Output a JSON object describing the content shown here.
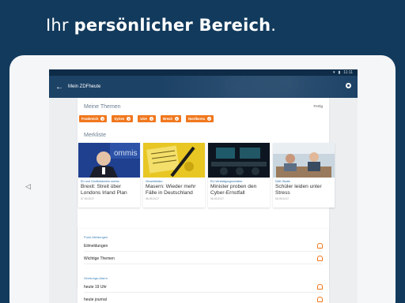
{
  "headline": {
    "light": "Ihr ",
    "bold": "persönlicher Bereich",
    "end": "."
  },
  "status": {
    "time": "11:11"
  },
  "appbar": {
    "title": "Mein ZDFheute"
  },
  "themen": {
    "title": "Meine Themen",
    "done": "Fertig",
    "chips": [
      "Frankreich",
      "Syrien",
      "USA",
      "Brexit",
      "Nordkorea"
    ]
  },
  "merkliste": {
    "title": "Merkliste",
    "items": [
      {
        "kicker": "EU und Großbritannien uneins",
        "title": "Brexit: Streit über Londons Irland Plan",
        "date": "07.09.2017"
      },
      {
        "kicker": "Virusinfektion",
        "title": "Masern: Wieder mehr Fälle in Deutschland",
        "date": "06.09.2017"
      },
      {
        "kicker": "EU-Verteidigungsminister",
        "title": "Minister proben den Cyber-Ernstfall",
        "date": "06.09.2017"
      },
      {
        "kicker": "DAK-Studie",
        "title": "Schüler leiden unter Stress",
        "date": "06.09.2017"
      }
    ]
  },
  "push": {
    "label": "Push-Meldungen",
    "rows": [
      "Eilmeldungen",
      "Wichtige Themen"
    ]
  },
  "sendungen": {
    "label": "Sendungs-Alarm",
    "rows": [
      "heute 19 Uhr",
      "heute journal"
    ]
  },
  "colors": {
    "accent": "#f0781e",
    "brand": "#1c4266",
    "link": "#2a6fa8"
  }
}
